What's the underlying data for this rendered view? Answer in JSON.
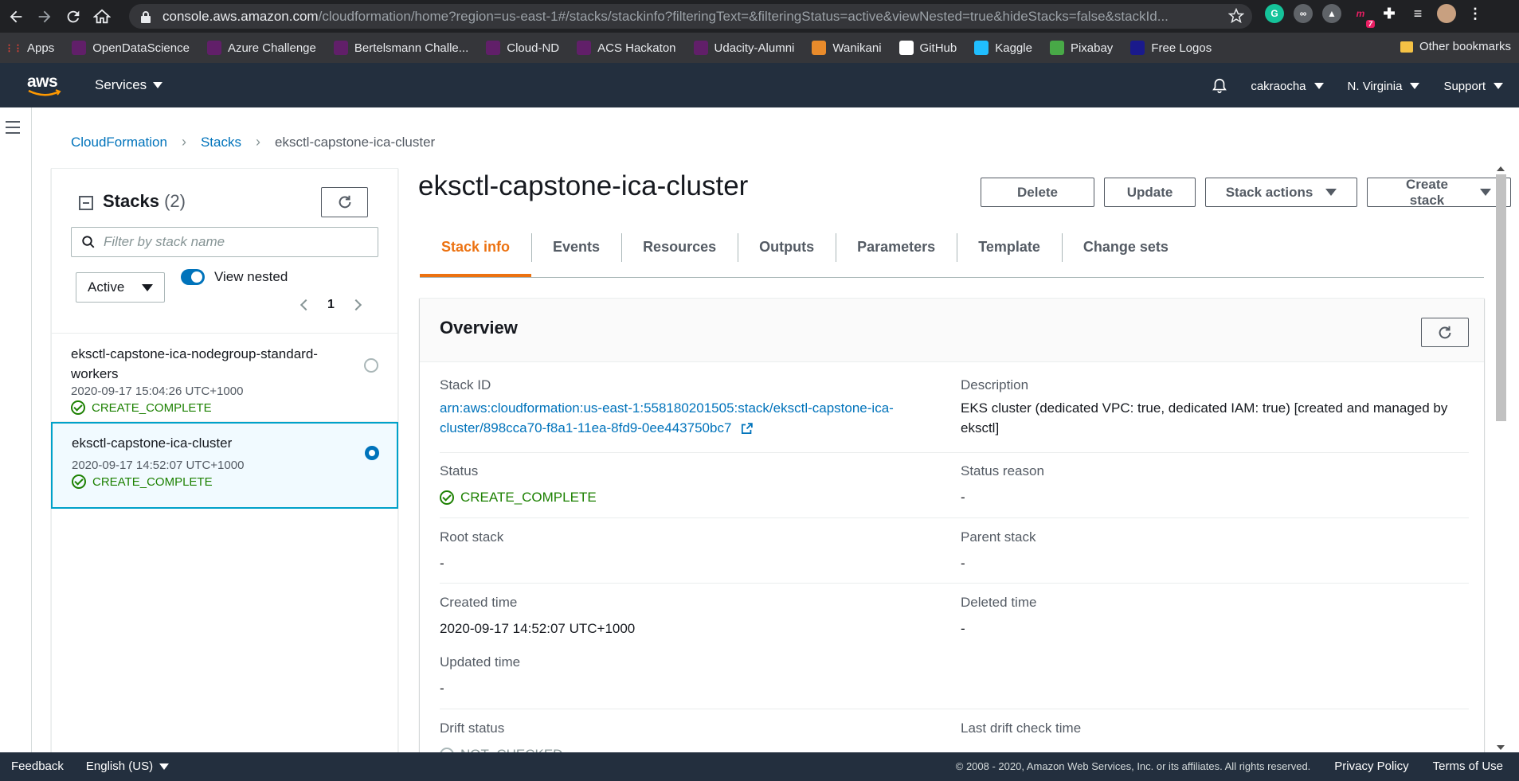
{
  "browser": {
    "url_host": "console.aws.amazon.com",
    "url_path": "/cloudformation/home?region=us-east-1#/stacks/stackinfo?filteringText=&filteringStatus=active&viewNested=true&hideStacks=false&stackId...",
    "ext_badge": "7",
    "bookmarks": [
      {
        "label": "Apps",
        "color": "#ea4335"
      },
      {
        "label": "OpenDataScience",
        "color": "#611f69"
      },
      {
        "label": "Azure Challenge",
        "color": "#611f69"
      },
      {
        "label": "Bertelsmann Challe...",
        "color": "#611f69"
      },
      {
        "label": "Cloud-ND",
        "color": "#611f69"
      },
      {
        "label": "ACS Hackaton",
        "color": "#611f69"
      },
      {
        "label": "Udacity-Alumni",
        "color": "#611f69"
      },
      {
        "label": "Wanikani",
        "color": "#e98b2b"
      },
      {
        "label": "GitHub",
        "color": "#ffffff"
      },
      {
        "label": "Kaggle",
        "color": "#20beff"
      },
      {
        "label": "Pixabay",
        "color": "#48a947"
      },
      {
        "label": "Free Logos",
        "color": "#1a1a8c"
      }
    ],
    "other_bookmarks": "Other bookmarks"
  },
  "aws_header": {
    "logo": "aws",
    "services": "Services",
    "user": "cakraocha",
    "region": "N. Virginia",
    "support": "Support"
  },
  "breadcrumb": {
    "items": [
      "CloudFormation",
      "Stacks"
    ],
    "current": "eksctl-capstone-ica-cluster"
  },
  "stacks_panel": {
    "title": "Stacks",
    "count": "(2)",
    "filter_placeholder": "Filter by stack name",
    "status_filter": "Active",
    "view_nested_label": "View nested",
    "page": "1",
    "stacks": [
      {
        "name": "eksctl-capstone-ica-nodegroup-standard-workers",
        "date": "2020-09-17 15:04:26 UTC+1000",
        "status": "CREATE_COMPLETE",
        "selected": false
      },
      {
        "name": "eksctl-capstone-ica-cluster",
        "date": "2020-09-17 14:52:07 UTC+1000",
        "status": "CREATE_COMPLETE",
        "selected": true
      }
    ]
  },
  "main": {
    "title": "eksctl-capstone-ica-cluster",
    "actions": {
      "delete": "Delete",
      "update": "Update",
      "stack_actions": "Stack actions",
      "create_stack": "Create stack"
    },
    "tabs": [
      "Stack info",
      "Events",
      "Resources",
      "Outputs",
      "Parameters",
      "Template",
      "Change sets"
    ],
    "active_tab": "Stack info",
    "overview": {
      "title": "Overview",
      "stack_id_label": "Stack ID",
      "stack_id_line1": "arn:aws:cloudformation:us-east-1:558180201505:stack/eksctl-capstone-ica-",
      "stack_id_line2": "cluster/898cca70-f8a1-11ea-8fd9-0ee443750bc7",
      "description_label": "Description",
      "description": "EKS cluster (dedicated VPC: true, dedicated IAM: true) [created and managed by eksctl]",
      "status_label": "Status",
      "status": "CREATE_COMPLETE",
      "status_reason_label": "Status reason",
      "status_reason": "-",
      "root_stack_label": "Root stack",
      "root_stack": "-",
      "parent_stack_label": "Parent stack",
      "parent_stack": "-",
      "created_time_label": "Created time",
      "created_time": "2020-09-17 14:52:07 UTC+1000",
      "deleted_time_label": "Deleted time",
      "deleted_time": "-",
      "updated_time_label": "Updated time",
      "updated_time": "-",
      "drift_status_label": "Drift status",
      "drift_status": "NOT_CHECKED",
      "last_drift_label": "Last drift check time"
    }
  },
  "footer": {
    "feedback": "Feedback",
    "language": "English (US)",
    "copyright": "© 2008 - 2020, Amazon Web Services, Inc. or its affiliates. All rights reserved.",
    "privacy": "Privacy Policy",
    "terms": "Terms of Use"
  },
  "colors": {
    "aws_navy": "#232f3e",
    "link_blue": "#0073bb",
    "accent_orange": "#ec7211",
    "success_green": "#1d8102"
  }
}
